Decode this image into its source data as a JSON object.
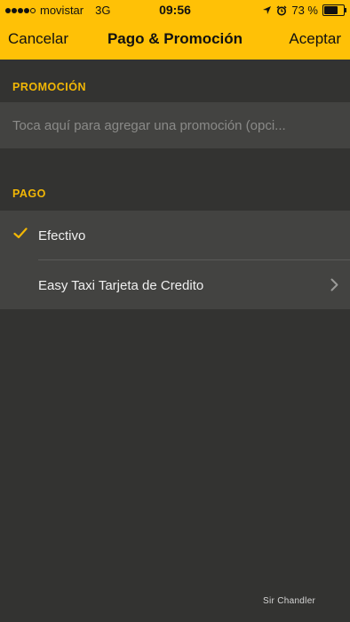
{
  "status_bar": {
    "carrier": "movistar",
    "network": "3G",
    "time": "09:56",
    "battery_percent": "73 %",
    "battery_level": 0.73,
    "signal_dots_filled": 4,
    "signal_dots_total": 5
  },
  "nav": {
    "cancel_label": "Cancelar",
    "title": "Pago & Promoción",
    "accept_label": "Aceptar"
  },
  "promotion": {
    "section_title": "PROMOCIÓN",
    "placeholder": "Toca aquí para agregar una promoción (opci...",
    "value": ""
  },
  "payment": {
    "section_title": "PAGO",
    "options": [
      {
        "label": "Efectivo",
        "selected": true
      },
      {
        "label": "Easy Taxi Tarjeta de Credito",
        "selected": false
      }
    ]
  },
  "watermark": "Sir Chandler",
  "colors": {
    "accent": "#FFC106",
    "section_title": "#F2B705",
    "background": "#333331",
    "row_background": "#434341"
  }
}
